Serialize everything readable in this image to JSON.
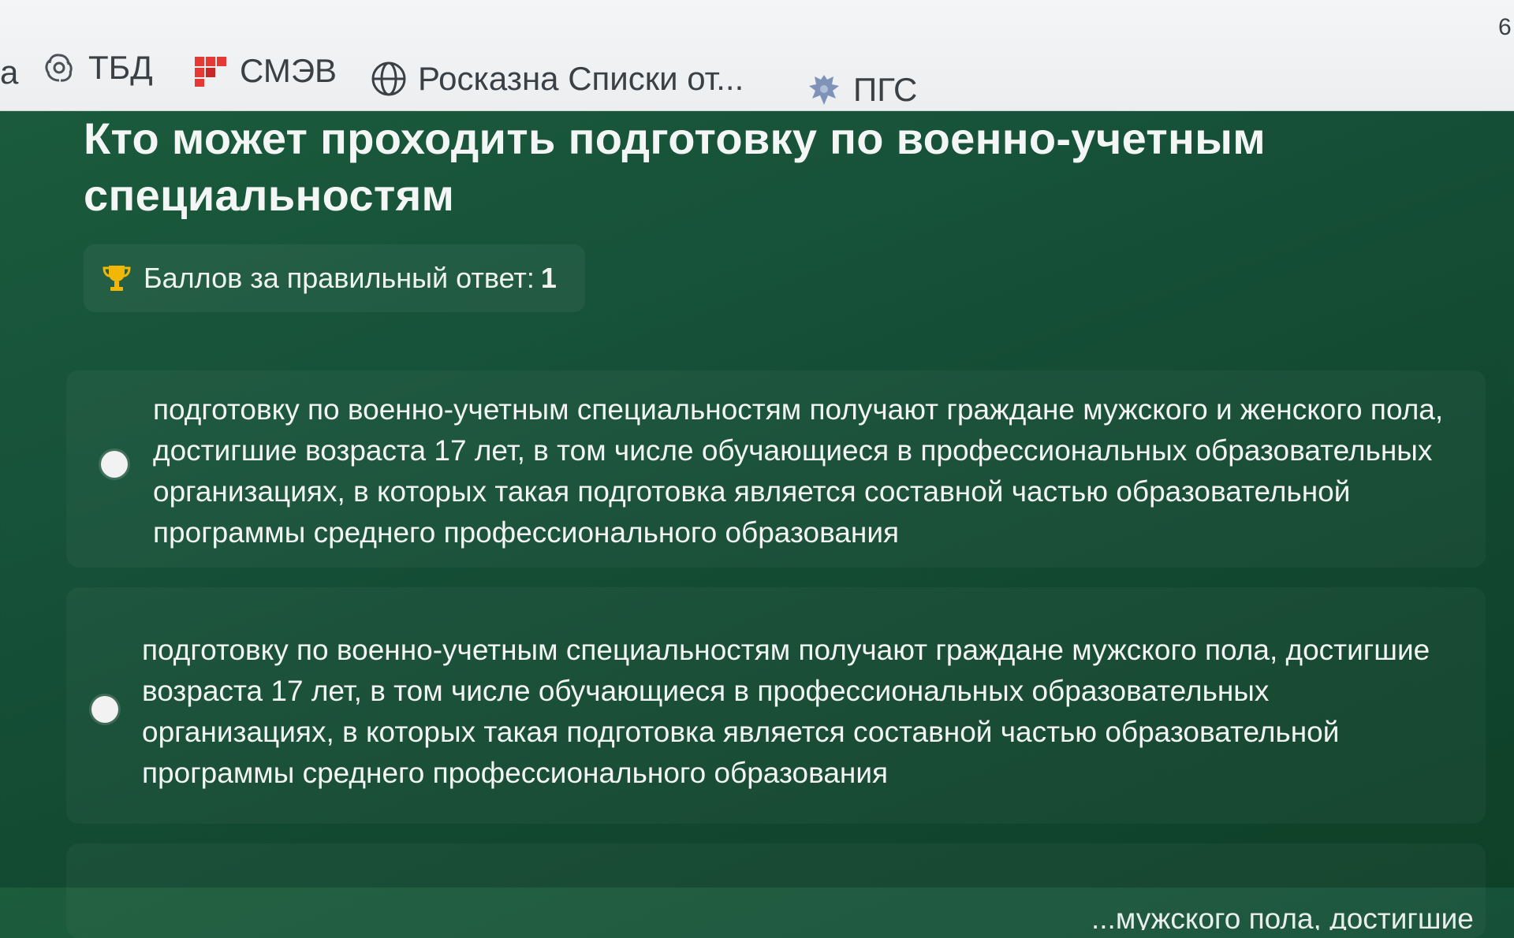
{
  "bookmarks": {
    "edge_glyph": "a",
    "corner_glyph": "6",
    "items": [
      {
        "label": "ТБД",
        "icon": "tbd-swirl-icon"
      },
      {
        "label": "СМЭВ",
        "icon": "smev-grid-icon"
      },
      {
        "label": "Росказна Списки от...",
        "icon": "globe-icon"
      },
      {
        "label": "ПГС",
        "icon": "coat-of-arms-icon"
      }
    ]
  },
  "question": {
    "title": "Кто может проходить подготовку по военно-учетным специальностям",
    "points_label": "Баллов за правильный ответ:",
    "points_value": "1"
  },
  "options": [
    {
      "text": "подготовку по военно-учетным специальностям получают граждане мужского и женского пола, достигшие возраста 17 лет, в том числе обучающиеся в профессиональных образовательных организациях, в которых такая подготовка является составной частью образовательной программы среднего профессионального образования",
      "selected": false
    },
    {
      "text": "подготовку по военно-учетным специальностям получают граждане мужского пола, достигшие возраста 17 лет, в том числе обучающиеся в профессиональных образовательных организациях, в которых такая подготовка является составной частью образовательной программы среднего профессионального образования",
      "selected": false
    },
    {
      "text": "...мужского пола, достигшие",
      "selected": false
    }
  ],
  "colors": {
    "background": "#17523a",
    "bookmarks_bar": "#eceef0",
    "radio": "#f2f2f2",
    "trophy": "#f2b705",
    "smev_red": "#e53935"
  }
}
